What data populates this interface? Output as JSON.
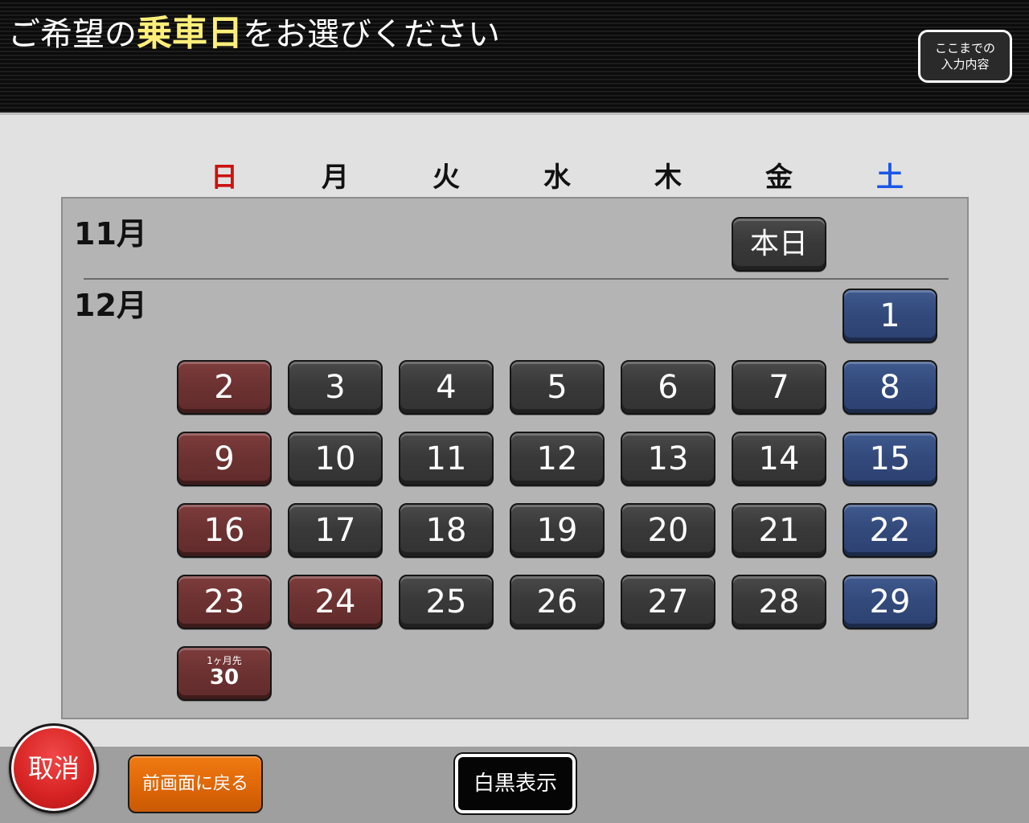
{
  "header": {
    "title_prefix": "ご希望の",
    "title_highlight": "乗車日",
    "title_suffix": "をお選びください",
    "summary_button": "ここまでの\n入力内容"
  },
  "weekdays": [
    "日",
    "月",
    "火",
    "水",
    "木",
    "金",
    "土"
  ],
  "calendar": {
    "months": [
      {
        "label": "11月",
        "today_button": "本日"
      },
      {
        "label": "12月"
      }
    ],
    "december_days": [
      {
        "day": "1",
        "weekday": "土"
      },
      {
        "day": "2",
        "weekday": "日"
      },
      {
        "day": "3",
        "weekday": "月"
      },
      {
        "day": "4",
        "weekday": "火"
      },
      {
        "day": "5",
        "weekday": "水"
      },
      {
        "day": "6",
        "weekday": "木"
      },
      {
        "day": "7",
        "weekday": "金"
      },
      {
        "day": "8",
        "weekday": "土"
      },
      {
        "day": "9",
        "weekday": "日"
      },
      {
        "day": "10",
        "weekday": "月"
      },
      {
        "day": "11",
        "weekday": "火"
      },
      {
        "day": "12",
        "weekday": "水"
      },
      {
        "day": "13",
        "weekday": "木"
      },
      {
        "day": "14",
        "weekday": "金"
      },
      {
        "day": "15",
        "weekday": "土"
      },
      {
        "day": "16",
        "weekday": "日"
      },
      {
        "day": "17",
        "weekday": "月"
      },
      {
        "day": "18",
        "weekday": "火"
      },
      {
        "day": "19",
        "weekday": "水"
      },
      {
        "day": "20",
        "weekday": "木"
      },
      {
        "day": "21",
        "weekday": "金"
      },
      {
        "day": "22",
        "weekday": "土"
      },
      {
        "day": "23",
        "weekday": "日"
      },
      {
        "day": "24",
        "weekday": "月",
        "holiday": true
      },
      {
        "day": "25",
        "weekday": "火"
      },
      {
        "day": "26",
        "weekday": "水"
      },
      {
        "day": "27",
        "weekday": "木"
      },
      {
        "day": "28",
        "weekday": "金"
      },
      {
        "day": "29",
        "weekday": "土"
      },
      {
        "day": "30",
        "weekday": "日",
        "note": "1ヶ月先"
      }
    ]
  },
  "footer": {
    "cancel_button": "取消",
    "back_button": "前画面に戻る",
    "monochrome_button": "白黒表示"
  },
  "colors": {
    "sunday_holiday": "#6d3232",
    "saturday": "#334a7c",
    "weekday": "#393939",
    "title_highlight": "#ffef7a",
    "cancel": "#d82424",
    "back": "#dc6507"
  }
}
